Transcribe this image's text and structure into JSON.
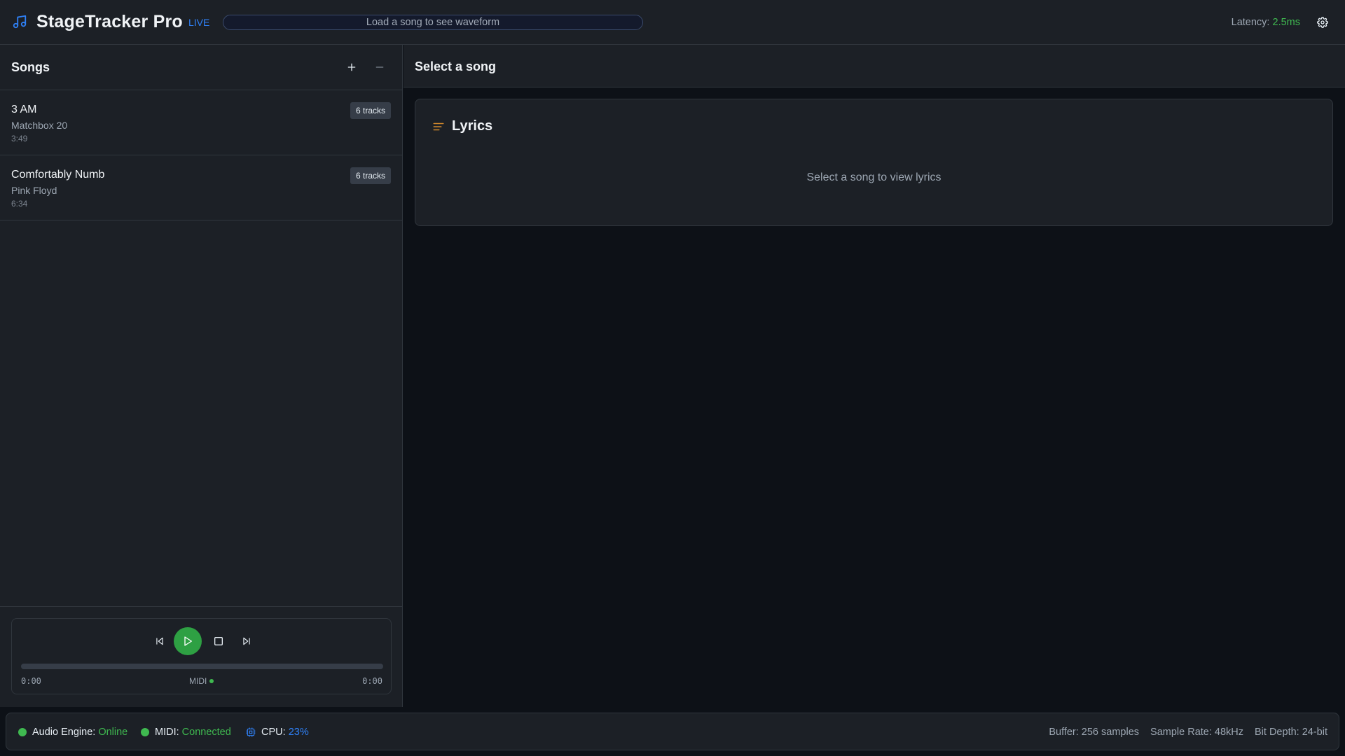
{
  "header": {
    "app_title": "StageTracker Pro",
    "live_label": "LIVE",
    "waveform_placeholder": "Load a song to see waveform",
    "latency_label": "Latency:",
    "latency_value": "2.5ms"
  },
  "sidebar": {
    "title": "Songs",
    "songs": [
      {
        "title": "3 AM",
        "artist": "Matchbox 20",
        "duration": "3:49",
        "tracks": "6 tracks"
      },
      {
        "title": "Comfortably Numb",
        "artist": "Pink Floyd",
        "duration": "6:34",
        "tracks": "6 tracks"
      }
    ]
  },
  "transport": {
    "current_time": "0:00",
    "total_time": "0:00",
    "midi_label": "MIDI",
    "progress": 0
  },
  "main": {
    "title": "Select a song",
    "lyrics_title": "Lyrics",
    "lyrics_empty": "Select a song to view lyrics"
  },
  "status": {
    "audio_label": "Audio Engine:",
    "audio_value": "Online",
    "midi_label": "MIDI:",
    "midi_value": "Connected",
    "cpu_label": "CPU:",
    "cpu_value": "23%",
    "buffer": "Buffer: 256 samples",
    "sample_rate": "Sample Rate: 48kHz",
    "bit_depth": "Bit Depth: 24-bit"
  },
  "colors": {
    "accent_blue": "#2f81f7",
    "accent_green": "#2ea043",
    "accent_orange": "#d2892b",
    "background": "#0d1117",
    "panel": "#1c2026"
  },
  "icons": {
    "logo": "music-note-icon",
    "settings": "gear-icon",
    "add": "plus-icon",
    "remove": "minus-icon",
    "prev": "skip-back-icon",
    "play": "play-icon",
    "stop": "stop-icon",
    "next": "skip-forward-icon",
    "lyrics": "align-left-icon",
    "cpu": "cpu-icon"
  }
}
